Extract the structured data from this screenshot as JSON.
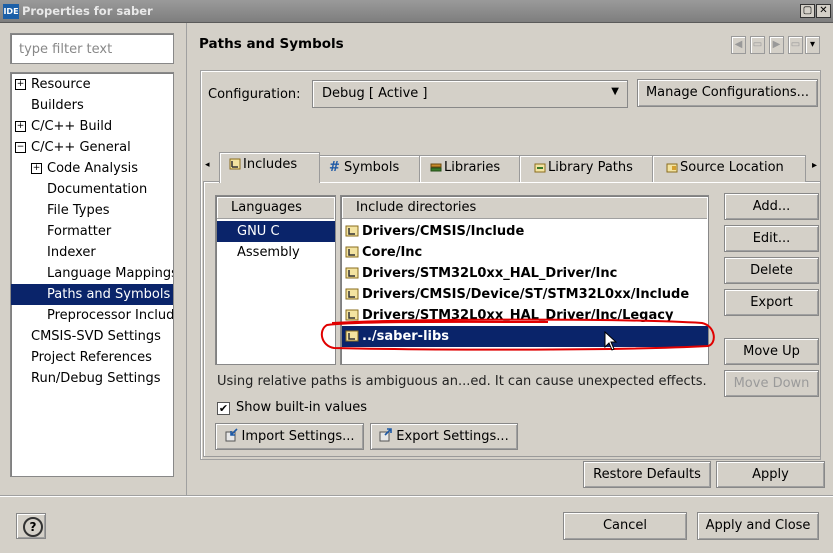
{
  "window": {
    "app_icon_text": "IDE",
    "title": "Properties for saber",
    "controls": [
      "▢",
      "✕"
    ]
  },
  "filter": {
    "placeholder": "type filter text",
    "value": ""
  },
  "tree": [
    {
      "label": "Resource",
      "depth": 0,
      "expander": "+"
    },
    {
      "label": "Builders",
      "depth": 0,
      "expander": ""
    },
    {
      "label": "C/C++ Build",
      "depth": 0,
      "expander": "+"
    },
    {
      "label": "C/C++ General",
      "depth": 0,
      "expander": "−"
    },
    {
      "label": "Code Analysis",
      "depth": 1,
      "expander": "+"
    },
    {
      "label": "Documentation",
      "depth": 1,
      "expander": ""
    },
    {
      "label": "File Types",
      "depth": 1,
      "expander": ""
    },
    {
      "label": "Formatter",
      "depth": 1,
      "expander": ""
    },
    {
      "label": "Indexer",
      "depth": 1,
      "expander": ""
    },
    {
      "label": "Language Mappings",
      "depth": 1,
      "expander": ""
    },
    {
      "label": "Paths and Symbols",
      "depth": 1,
      "expander": "",
      "selected": true
    },
    {
      "label": "Preprocessor Includ",
      "depth": 1,
      "expander": ""
    },
    {
      "label": "CMSIS-SVD Settings",
      "depth": 0,
      "expander": ""
    },
    {
      "label": "Project References",
      "depth": 0,
      "expander": ""
    },
    {
      "label": "Run/Debug Settings",
      "depth": 0,
      "expander": ""
    }
  ],
  "page": {
    "title": "Paths and Symbols"
  },
  "configuration": {
    "label": "Configuration:",
    "value": "Debug  [ Active ]",
    "manage_label": "Manage Configurations..."
  },
  "tabs": [
    {
      "label": "Includes",
      "active": true
    },
    {
      "label": "Symbols"
    },
    {
      "label": "Libraries"
    },
    {
      "label": "Library Paths"
    },
    {
      "label": "Source Location"
    }
  ],
  "languages": {
    "header": "Languages",
    "items": [
      {
        "label": "GNU C",
        "selected": true
      },
      {
        "label": "Assembly"
      }
    ]
  },
  "includes": {
    "header": "Include directories",
    "items": [
      {
        "label": "Drivers/CMSIS/Include"
      },
      {
        "label": "Core/Inc"
      },
      {
        "label": "Drivers/STM32L0xx_HAL_Driver/Inc"
      },
      {
        "label": "Drivers/CMSIS/Device/ST/STM32L0xx/Include"
      },
      {
        "label": "Drivers/STM32L0xx_HAL_Driver/Inc/Legacy"
      },
      {
        "label": "../saber-libs",
        "selected": true
      }
    ]
  },
  "side_buttons": {
    "add": "Add...",
    "edit": "Edit...",
    "delete": "Delete",
    "export": "Export",
    "move_up": "Move Up",
    "move_down": "Move Down"
  },
  "warning_text": "Using relative paths is ambiguous an...ed. It can cause unexpected effects.",
  "show_builtin": {
    "label": "Show built-in values",
    "checked": true
  },
  "import_settings": "Import Settings...",
  "export_settings": "Export Settings...",
  "restore_defaults": "Restore Defaults",
  "apply": "Apply",
  "cancel": "Cancel",
  "apply_and_close": "Apply and Close",
  "help_icon_text": "?",
  "colors": {
    "selection": "#0a246a",
    "annotation": "#e00000",
    "titlebar": "#8a8a8a"
  }
}
